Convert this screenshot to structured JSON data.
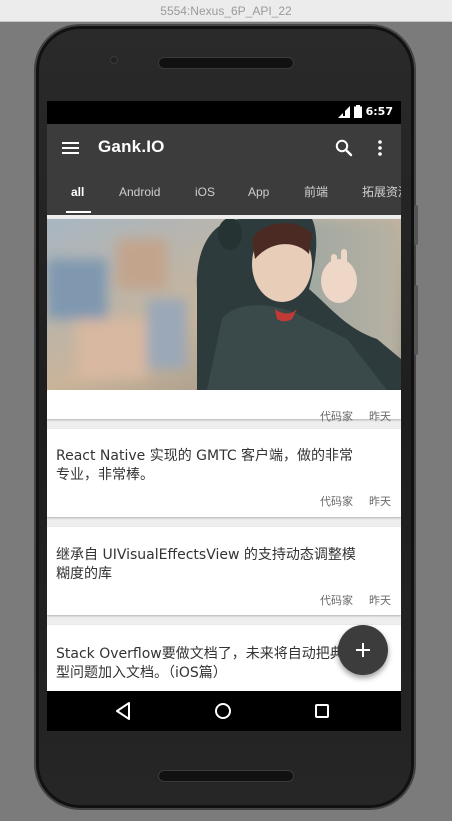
{
  "window": {
    "title": "5554:Nexus_6P_API_22"
  },
  "status_bar": {
    "time": "6:57"
  },
  "toolbar": {
    "title": "Gank.IO"
  },
  "tabs": [
    {
      "label": "all"
    },
    {
      "label": "Android"
    },
    {
      "label": "iOS"
    },
    {
      "label": "App"
    },
    {
      "label": "前端"
    },
    {
      "label": "拓展资源"
    }
  ],
  "cards": [
    {
      "text": "",
      "author": "代码家",
      "date": "昨天",
      "has_image": true
    },
    {
      "text": "React Native 实现的 GMTC 客户端，做的非常专业，非常棒。",
      "author": "代码家",
      "date": "昨天"
    },
    {
      "text": "继承自 UIVisualEffectsView 的支持动态调整模糊度的库",
      "author": "代码家",
      "date": "昨天"
    },
    {
      "text": "Stack Overflow要做文档了，未来将自动把典型问题加入文档。（iOS篇）",
      "author": "",
      "date": ""
    }
  ],
  "colors": {
    "toolbar": "#3c3c3c",
    "background": "#eeeeee",
    "fab": "#3c3c3c"
  }
}
